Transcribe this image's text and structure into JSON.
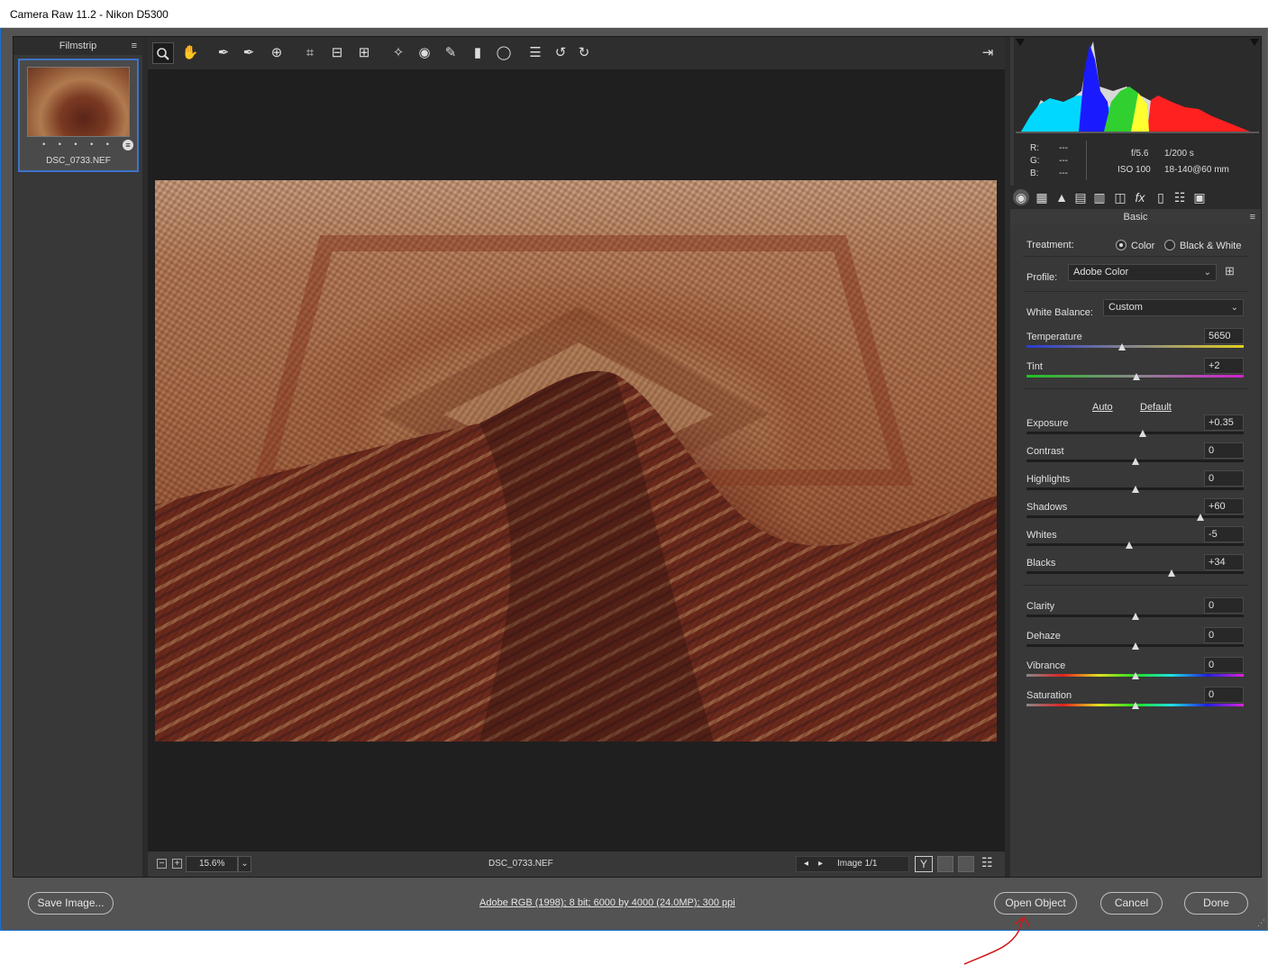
{
  "window": {
    "title": "Camera Raw 11.2  -  Nikon D5300"
  },
  "filmstrip": {
    "header": "Filmstrip",
    "menu_icon": "≡",
    "thumb_dots": "• • • • •",
    "thumb_name": "DSC_0733.NEF"
  },
  "toolbar": {
    "tools": [
      "zoom",
      "hand",
      "white-balance",
      "color-sampler",
      "targeted-adjustment",
      "crop",
      "straighten",
      "transform",
      "spot-removal",
      "red-eye",
      "adjustment-brush",
      "graduated-filter",
      "radial-filter",
      "preferences",
      "rotate-ccw",
      "rotate-cw"
    ],
    "fullscreen": "toggle-fullscreen"
  },
  "statusbar": {
    "zoom": "15.6%",
    "filename": "DSC_0733.NEF",
    "image_count": "Image 1/1",
    "y_label": "Y"
  },
  "metadata": {
    "r_label": "R:",
    "g_label": "G:",
    "b_label": "B:",
    "r": "---",
    "g": "---",
    "b": "---",
    "aperture": "f/5.6",
    "shutter": "1/200 s",
    "iso": "ISO 100",
    "lens": "18-140@60 mm"
  },
  "panel": {
    "title": "Basic",
    "menu": "≡",
    "treatment_label": "Treatment:",
    "treatment_color": "Color",
    "treatment_bw": "Black & White",
    "profile_label": "Profile:",
    "profile_value": "Adobe Color",
    "wb_label": "White Balance:",
    "wb_value": "Custom",
    "auto": "Auto",
    "default": "Default",
    "sliders": [
      {
        "label": "Temperature",
        "value": "5650",
        "pos": 0.44
      },
      {
        "label": "Tint",
        "value": "+2",
        "pos": 0.505
      },
      {
        "label": "Exposure",
        "value": "+0.35",
        "pos": 0.535
      },
      {
        "label": "Contrast",
        "value": "0",
        "pos": 0.5
      },
      {
        "label": "Highlights",
        "value": "0",
        "pos": 0.5
      },
      {
        "label": "Shadows",
        "value": "+60",
        "pos": 0.8
      },
      {
        "label": "Whites",
        "value": "-5",
        "pos": 0.475
      },
      {
        "label": "Blacks",
        "value": "+34",
        "pos": 0.67
      },
      {
        "label": "Clarity",
        "value": "0",
        "pos": 0.5
      },
      {
        "label": "Dehaze",
        "value": "0",
        "pos": 0.5
      },
      {
        "label": "Vibrance",
        "value": "0",
        "pos": 0.5
      },
      {
        "label": "Saturation",
        "value": "0",
        "pos": 0.5
      }
    ]
  },
  "footer": {
    "save": "Save Image...",
    "workflow": "Adobe RGB (1998); 8 bit; 6000 by 4000 (24.0MP); 300 ppi",
    "open": "Open Object",
    "cancel": "Cancel",
    "done": "Done"
  }
}
